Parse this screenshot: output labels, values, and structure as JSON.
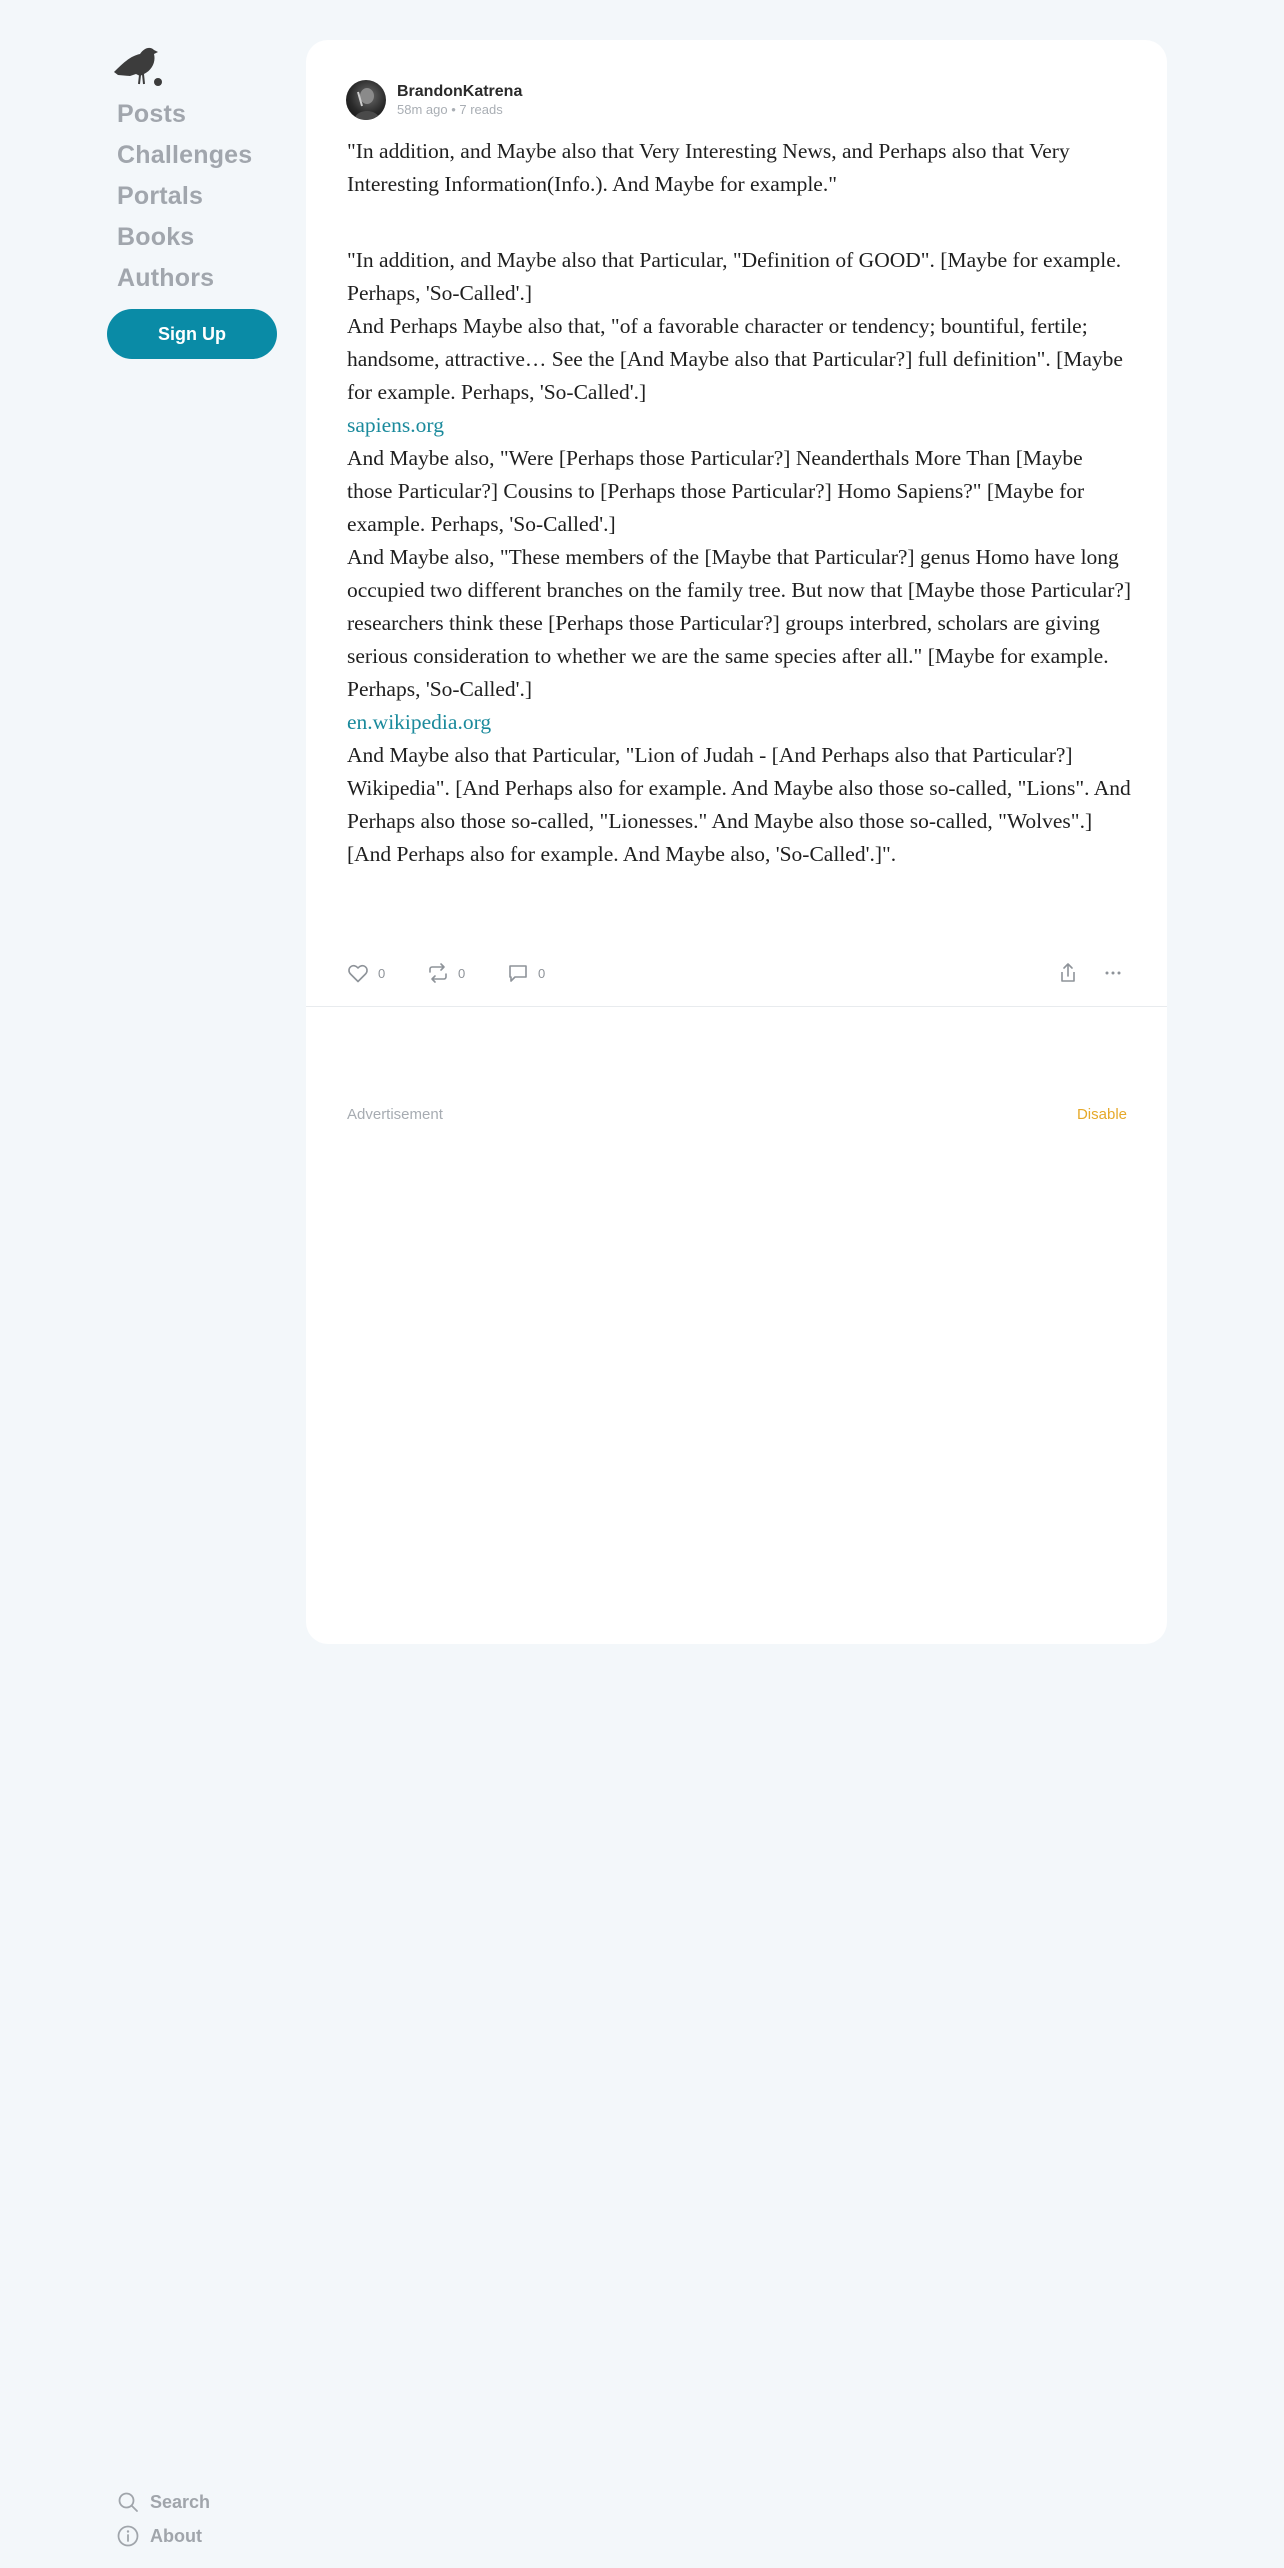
{
  "sidebar": {
    "logo": "crow-logo",
    "nav": [
      {
        "label": "Posts"
      },
      {
        "label": "Challenges"
      },
      {
        "label": "Portals"
      },
      {
        "label": "Books"
      },
      {
        "label": "Authors"
      }
    ],
    "signup_label": "Sign Up"
  },
  "footer": {
    "search_label": "Search",
    "about_label": "About"
  },
  "post": {
    "author": "BrandonKatrena",
    "meta": "58m ago • 7 reads",
    "paragraphs": [
      "\"In addition, and Maybe also that Very Interesting News, and Perhaps also that Very Interesting Information(Info.). And Maybe for example.\"",
      "\"In addition, and Maybe also that Particular, \"Definition of GOOD\". [Maybe for example. Perhaps, 'So-Called'.]",
      "And Perhaps Maybe also that, \"of a favorable character or tendency; bountiful, fertile; handsome, attractive… See the [And Maybe also that Particular?] full definition\". [Maybe for example. Perhaps, 'So-Called'.]",
      "sapiens.org",
      "And Maybe also, \"Were [Perhaps those Particular?] Neanderthals More Than [Maybe those Particular?] Cousins to [Perhaps those Particular?] Homo Sapiens?\" [Maybe for example. Perhaps, 'So-Called'.]",
      "And Maybe also, \"These members of the [Maybe that Particular?] genus Homo have long occupied two different branches on the family tree. But now that [Maybe those Particular?] researchers think these [Perhaps those Particular?] groups interbred, scholars are giving serious consideration to whether we are the same species after all.\" [Maybe for example. Perhaps, 'So-Called'.]",
      "en.wikipedia.org",
      "And Maybe also that Particular, \"Lion of Judah - [And Perhaps also that Particular?] Wikipedia\". [And Perhaps also for example. And Maybe also those so-called, \"Lions\". And Perhaps also those so-called, \"Lionesses.\" And Maybe also those so-called, \"Wolves\".] [And Perhaps also for example. And Maybe also, 'So-Called'.]\"."
    ],
    "likes": "0",
    "reposts": "0",
    "comments": "0"
  },
  "ad": {
    "label": "Advertisement",
    "disable_label": "Disable"
  },
  "colors": {
    "accent": "#0a8ba6",
    "link": "#1a8a9c",
    "disable": "#e6a92a",
    "background": "#f3f7fa"
  }
}
